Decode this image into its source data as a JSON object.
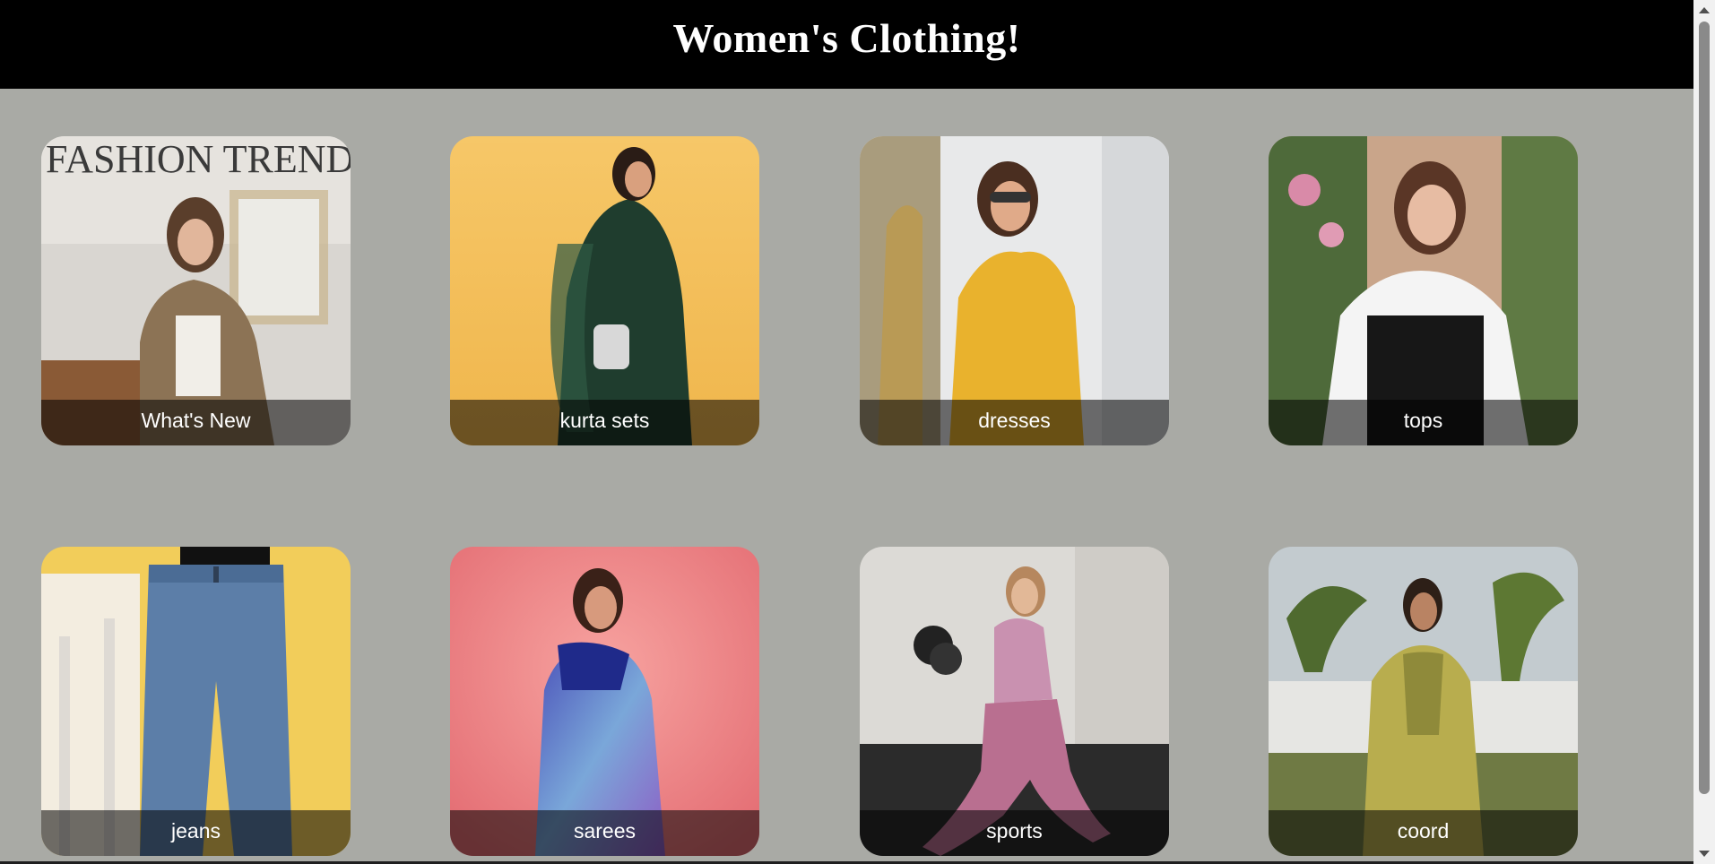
{
  "header": {
    "title": "Women's Clothing!"
  },
  "categories": [
    {
      "label": "What's New"
    },
    {
      "label": "kurta sets"
    },
    {
      "label": "dresses"
    },
    {
      "label": "tops"
    },
    {
      "label": "jeans"
    },
    {
      "label": "sarees"
    },
    {
      "label": "sports"
    },
    {
      "label": "coord"
    }
  ]
}
